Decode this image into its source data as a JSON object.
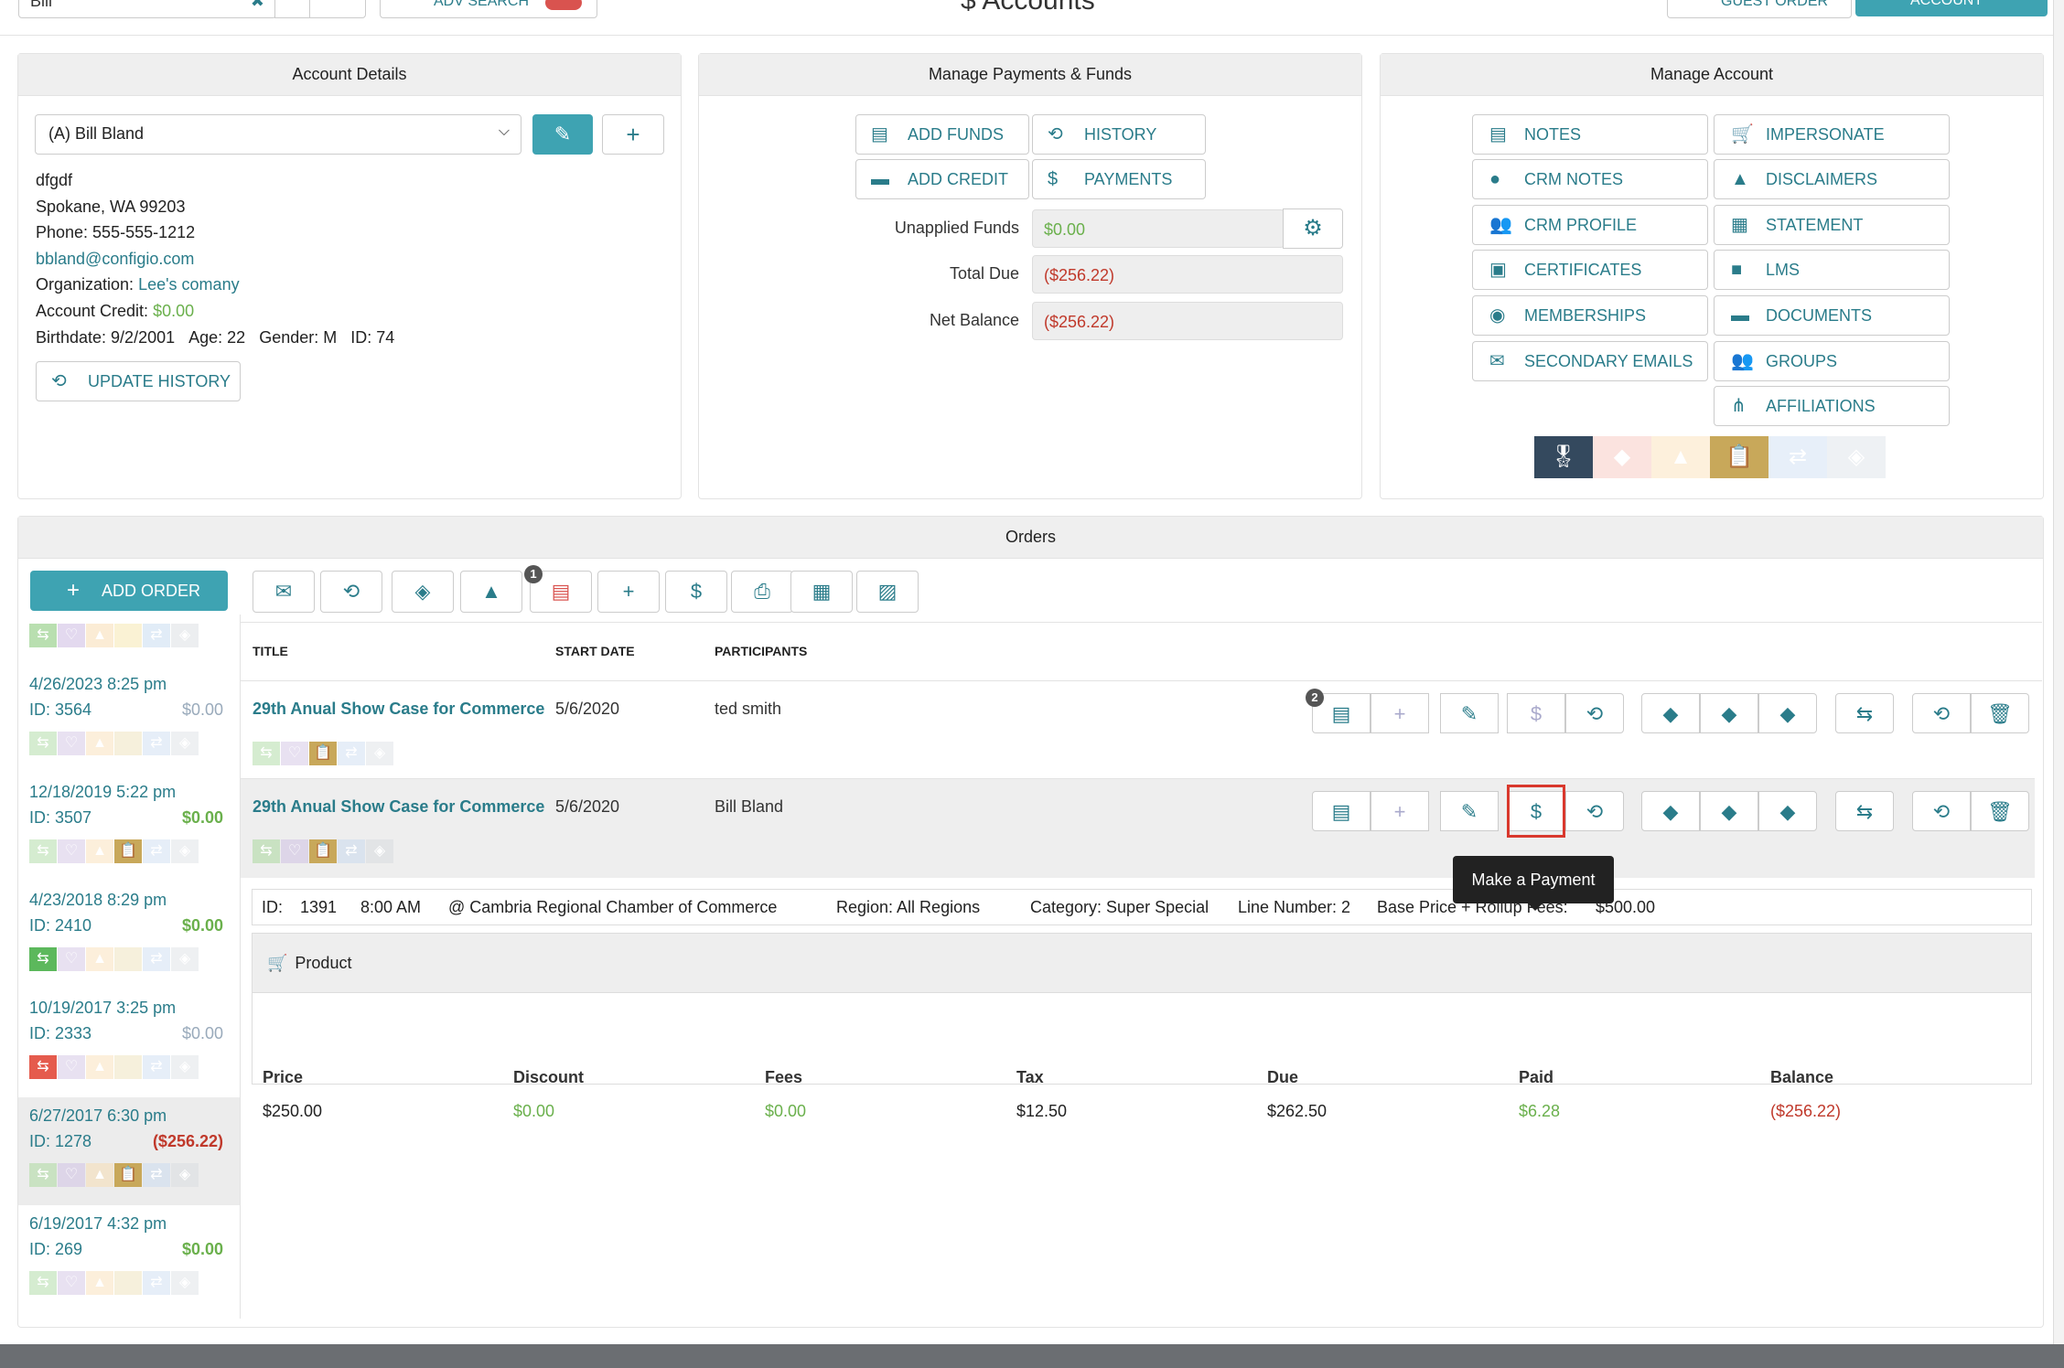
{
  "topbar": {
    "search_value": "Bill",
    "adv_search_label": "ADV SEARCH",
    "page_title": "$  Accounts",
    "guest_order_label": "GUEST ORDER",
    "account_label": "ACCOUNT"
  },
  "account_details": {
    "header": "Account Details",
    "selected_account": "(A) Bill Bland",
    "address_line1": "dfgdf",
    "address_line2": "Spokane, WA 99203",
    "phone": "Phone: 555-555-1212",
    "email": "bbland@configio.com",
    "org_label": "Organization:",
    "org_value": "Lee's comany",
    "credit_label": "Account Credit:",
    "credit_value": "$0.00",
    "birthdate": "Birthdate: 9/2/2001",
    "age": "Age: 22",
    "gender": "Gender: M",
    "id": "ID: 74",
    "update_history_label": "UPDATE HISTORY"
  },
  "payments": {
    "header": "Manage Payments & Funds",
    "add_funds": "ADD FUNDS",
    "history": "HISTORY",
    "add_credit": "ADD CREDIT",
    "payments": "PAYMENTS",
    "unapplied_label": "Unapplied Funds",
    "unapplied_value": "$0.00",
    "total_due_label": "Total Due",
    "total_due_value": "($256.22)",
    "net_balance_label": "Net Balance",
    "net_balance_value": "($256.22)"
  },
  "manage_account": {
    "header": "Manage Account",
    "buttons": [
      "NOTES",
      "IMPERSONATE",
      "CRM NOTES",
      "DISCLAIMERS",
      "CRM PROFILE",
      "STATEMENT",
      "CERTIFICATES",
      "LMS",
      "MEMBERSHIPS",
      "DOCUMENTS",
      "SECONDARY EMAILS",
      "GROUPS",
      "AFFILIATIONS"
    ]
  },
  "orders": {
    "header": "Orders",
    "add_order_label": "ADD ORDER",
    "toolbar_badge": "1",
    "columns": {
      "title": "TITLE",
      "start_date": "START DATE",
      "participants": "PARTICIPANTS"
    },
    "sidebar": [
      {
        "date": "4/26/2023 8:25 pm",
        "id": "ID: 3564",
        "amount": "$0.00"
      },
      {
        "date": "12/18/2019 5:22 pm",
        "id": "ID: 3507",
        "amount": "$0.00"
      },
      {
        "date": "4/23/2018 8:29 pm",
        "id": "ID: 2410",
        "amount": "$0.00"
      },
      {
        "date": "10/19/2017 3:25 pm",
        "id": "ID: 2333",
        "amount": "$0.00"
      },
      {
        "date": "6/27/2017 6:30 pm",
        "id": "ID: 1278",
        "amount": "($256.22)"
      },
      {
        "date": "6/19/2017 4:32 pm",
        "id": "ID: 269",
        "amount": "$0.00"
      }
    ],
    "rows": [
      {
        "title": "29th Anual Show Case for Commerce",
        "start_date": "5/6/2020",
        "participant": "ted smith",
        "badge": "2"
      },
      {
        "title": "29th Anual Show Case for Commerce",
        "start_date": "5/6/2020",
        "participant": "Bill Bland"
      }
    ],
    "detail": {
      "id_label": "ID:",
      "id_value": "1391",
      "time": "8:00 AM",
      "location": "@ Cambria Regional Chamber of Commerce",
      "region": "Region: All Regions",
      "category": "Category: Super Special",
      "line_number": "Line Number: 2",
      "base_price": "Base Price + Rollup Fees:",
      "base_value": "$500.00"
    },
    "product": {
      "header": "Product",
      "headers": [
        "Price",
        "Discount",
        "Fees",
        "Tax",
        "Due",
        "Paid",
        "Balance"
      ],
      "values": [
        "$250.00",
        "$0.00",
        "$0.00",
        "$12.50",
        "$262.50",
        "$6.28",
        "($256.22)"
      ]
    },
    "tooltip": "Make a Payment"
  },
  "colors": {
    "accent": "#3ea3b2",
    "link": "#2a7c8a",
    "green": "#6ab04c",
    "red": "#c0392b"
  }
}
